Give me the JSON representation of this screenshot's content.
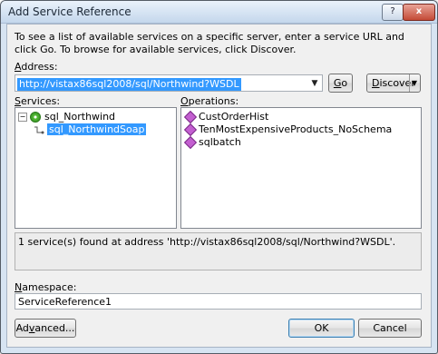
{
  "window": {
    "title": "Add Service Reference",
    "help_label": "?",
    "close_label": "x"
  },
  "description": "To see a list of available services on a specific server, enter a service URL and click Go. To browse for available services, click Discover.",
  "address": {
    "label_prefix": "",
    "label_access": "A",
    "label_rest": "ddress:",
    "value": "http://vistax86sql2008/sql/Northwind?WSDL"
  },
  "buttons": {
    "go_access": "G",
    "go_rest": "o",
    "discover_access": "D",
    "discover_rest": "iscover",
    "advanced_prefix": "Ad",
    "advanced_access": "v",
    "advanced_rest": "anced...",
    "ok": "OK",
    "cancel": "Cancel"
  },
  "services": {
    "label_access": "S",
    "label_rest": "ervices:",
    "root": "sql_Northwind",
    "child": "sql_NorthwindSoap",
    "expander": "−"
  },
  "operations": {
    "label_access": "O",
    "label_rest": "perations:",
    "items": [
      "CustOrderHist",
      "TenMostExpensiveProducts_NoSchema",
      "sqlbatch"
    ]
  },
  "status_text": "1 service(s) found at address 'http://vistax86sql2008/sql/Northwind?WSDL'.",
  "namespace": {
    "label_access": "N",
    "label_rest": "amespace:",
    "value": "ServiceReference1"
  },
  "colors": {
    "selection": "#3399ff",
    "dialog_bg": "#f0f0f0",
    "frame": "#d7e4f2"
  }
}
